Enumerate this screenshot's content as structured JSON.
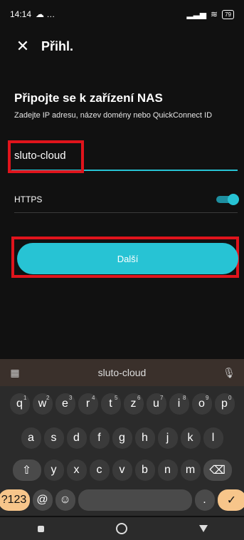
{
  "status": {
    "time": "14:14",
    "extra": "☁ …",
    "battery": "79"
  },
  "header": {
    "title": "Přihl.",
    "close_icon": "✕"
  },
  "main": {
    "title": "Připojte se k zařízení NAS",
    "subtitle": "Zadejte IP adresu, název domény nebo QuickConnect ID",
    "input": {
      "value": "sluto-cloud"
    },
    "https_label": "HTTPS",
    "https_enabled": true,
    "next_label": "Další"
  },
  "keyboard": {
    "suggestion": "sluto-cloud",
    "row1": [
      {
        "k": "q",
        "s": "1"
      },
      {
        "k": "w",
        "s": "2"
      },
      {
        "k": "e",
        "s": "3"
      },
      {
        "k": "r",
        "s": "4"
      },
      {
        "k": "t",
        "s": "5"
      },
      {
        "k": "z",
        "s": "6"
      },
      {
        "k": "u",
        "s": "7"
      },
      {
        "k": "i",
        "s": "8"
      },
      {
        "k": "o",
        "s": "9"
      },
      {
        "k": "p",
        "s": "0"
      }
    ],
    "row2": [
      "a",
      "s",
      "d",
      "f",
      "g",
      "h",
      "j",
      "k",
      "l"
    ],
    "row3": [
      "y",
      "x",
      "c",
      "v",
      "b",
      "n",
      "m"
    ],
    "row4": {
      "num_label": "?123",
      "at": "@",
      "emoji": "☺",
      "dot": ".",
      "done": "✓"
    }
  },
  "colors": {
    "accent": "#27c3d4",
    "highlight": "#e0141c"
  }
}
